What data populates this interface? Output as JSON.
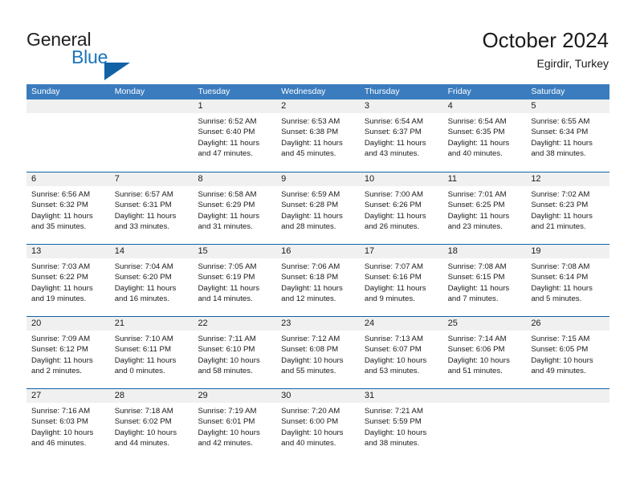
{
  "brand": {
    "name_top": "General",
    "name_bottom": "Blue",
    "accent_color": "#1261a6"
  },
  "header": {
    "title": "October 2024",
    "location": "Egirdir, Turkey"
  },
  "theme": {
    "header_blue": "#3a7cbe",
    "row_rule_blue": "#1261a6",
    "day_band_gray": "#f0f0f0"
  },
  "weekdays": [
    "Sunday",
    "Monday",
    "Tuesday",
    "Wednesday",
    "Thursday",
    "Friday",
    "Saturday"
  ],
  "weeks": [
    [
      {
        "day": "",
        "lines": []
      },
      {
        "day": "",
        "lines": []
      },
      {
        "day": "1",
        "lines": [
          "Sunrise: 6:52 AM",
          "Sunset: 6:40 PM",
          "Daylight: 11 hours",
          "and 47 minutes."
        ]
      },
      {
        "day": "2",
        "lines": [
          "Sunrise: 6:53 AM",
          "Sunset: 6:38 PM",
          "Daylight: 11 hours",
          "and 45 minutes."
        ]
      },
      {
        "day": "3",
        "lines": [
          "Sunrise: 6:54 AM",
          "Sunset: 6:37 PM",
          "Daylight: 11 hours",
          "and 43 minutes."
        ]
      },
      {
        "day": "4",
        "lines": [
          "Sunrise: 6:54 AM",
          "Sunset: 6:35 PM",
          "Daylight: 11 hours",
          "and 40 minutes."
        ]
      },
      {
        "day": "5",
        "lines": [
          "Sunrise: 6:55 AM",
          "Sunset: 6:34 PM",
          "Daylight: 11 hours",
          "and 38 minutes."
        ]
      }
    ],
    [
      {
        "day": "6",
        "lines": [
          "Sunrise: 6:56 AM",
          "Sunset: 6:32 PM",
          "Daylight: 11 hours",
          "and 35 minutes."
        ]
      },
      {
        "day": "7",
        "lines": [
          "Sunrise: 6:57 AM",
          "Sunset: 6:31 PM",
          "Daylight: 11 hours",
          "and 33 minutes."
        ]
      },
      {
        "day": "8",
        "lines": [
          "Sunrise: 6:58 AM",
          "Sunset: 6:29 PM",
          "Daylight: 11 hours",
          "and 31 minutes."
        ]
      },
      {
        "day": "9",
        "lines": [
          "Sunrise: 6:59 AM",
          "Sunset: 6:28 PM",
          "Daylight: 11 hours",
          "and 28 minutes."
        ]
      },
      {
        "day": "10",
        "lines": [
          "Sunrise: 7:00 AM",
          "Sunset: 6:26 PM",
          "Daylight: 11 hours",
          "and 26 minutes."
        ]
      },
      {
        "day": "11",
        "lines": [
          "Sunrise: 7:01 AM",
          "Sunset: 6:25 PM",
          "Daylight: 11 hours",
          "and 23 minutes."
        ]
      },
      {
        "day": "12",
        "lines": [
          "Sunrise: 7:02 AM",
          "Sunset: 6:23 PM",
          "Daylight: 11 hours",
          "and 21 minutes."
        ]
      }
    ],
    [
      {
        "day": "13",
        "lines": [
          "Sunrise: 7:03 AM",
          "Sunset: 6:22 PM",
          "Daylight: 11 hours",
          "and 19 minutes."
        ]
      },
      {
        "day": "14",
        "lines": [
          "Sunrise: 7:04 AM",
          "Sunset: 6:20 PM",
          "Daylight: 11 hours",
          "and 16 minutes."
        ]
      },
      {
        "day": "15",
        "lines": [
          "Sunrise: 7:05 AM",
          "Sunset: 6:19 PM",
          "Daylight: 11 hours",
          "and 14 minutes."
        ]
      },
      {
        "day": "16",
        "lines": [
          "Sunrise: 7:06 AM",
          "Sunset: 6:18 PM",
          "Daylight: 11 hours",
          "and 12 minutes."
        ]
      },
      {
        "day": "17",
        "lines": [
          "Sunrise: 7:07 AM",
          "Sunset: 6:16 PM",
          "Daylight: 11 hours",
          "and 9 minutes."
        ]
      },
      {
        "day": "18",
        "lines": [
          "Sunrise: 7:08 AM",
          "Sunset: 6:15 PM",
          "Daylight: 11 hours",
          "and 7 minutes."
        ]
      },
      {
        "day": "19",
        "lines": [
          "Sunrise: 7:08 AM",
          "Sunset: 6:14 PM",
          "Daylight: 11 hours",
          "and 5 minutes."
        ]
      }
    ],
    [
      {
        "day": "20",
        "lines": [
          "Sunrise: 7:09 AM",
          "Sunset: 6:12 PM",
          "Daylight: 11 hours",
          "and 2 minutes."
        ]
      },
      {
        "day": "21",
        "lines": [
          "Sunrise: 7:10 AM",
          "Sunset: 6:11 PM",
          "Daylight: 11 hours",
          "and 0 minutes."
        ]
      },
      {
        "day": "22",
        "lines": [
          "Sunrise: 7:11 AM",
          "Sunset: 6:10 PM",
          "Daylight: 10 hours",
          "and 58 minutes."
        ]
      },
      {
        "day": "23",
        "lines": [
          "Sunrise: 7:12 AM",
          "Sunset: 6:08 PM",
          "Daylight: 10 hours",
          "and 55 minutes."
        ]
      },
      {
        "day": "24",
        "lines": [
          "Sunrise: 7:13 AM",
          "Sunset: 6:07 PM",
          "Daylight: 10 hours",
          "and 53 minutes."
        ]
      },
      {
        "day": "25",
        "lines": [
          "Sunrise: 7:14 AM",
          "Sunset: 6:06 PM",
          "Daylight: 10 hours",
          "and 51 minutes."
        ]
      },
      {
        "day": "26",
        "lines": [
          "Sunrise: 7:15 AM",
          "Sunset: 6:05 PM",
          "Daylight: 10 hours",
          "and 49 minutes."
        ]
      }
    ],
    [
      {
        "day": "27",
        "lines": [
          "Sunrise: 7:16 AM",
          "Sunset: 6:03 PM",
          "Daylight: 10 hours",
          "and 46 minutes."
        ]
      },
      {
        "day": "28",
        "lines": [
          "Sunrise: 7:18 AM",
          "Sunset: 6:02 PM",
          "Daylight: 10 hours",
          "and 44 minutes."
        ]
      },
      {
        "day": "29",
        "lines": [
          "Sunrise: 7:19 AM",
          "Sunset: 6:01 PM",
          "Daylight: 10 hours",
          "and 42 minutes."
        ]
      },
      {
        "day": "30",
        "lines": [
          "Sunrise: 7:20 AM",
          "Sunset: 6:00 PM",
          "Daylight: 10 hours",
          "and 40 minutes."
        ]
      },
      {
        "day": "31",
        "lines": [
          "Sunrise: 7:21 AM",
          "Sunset: 5:59 PM",
          "Daylight: 10 hours",
          "and 38 minutes."
        ]
      },
      {
        "day": "",
        "lines": []
      },
      {
        "day": "",
        "lines": []
      }
    ]
  ]
}
